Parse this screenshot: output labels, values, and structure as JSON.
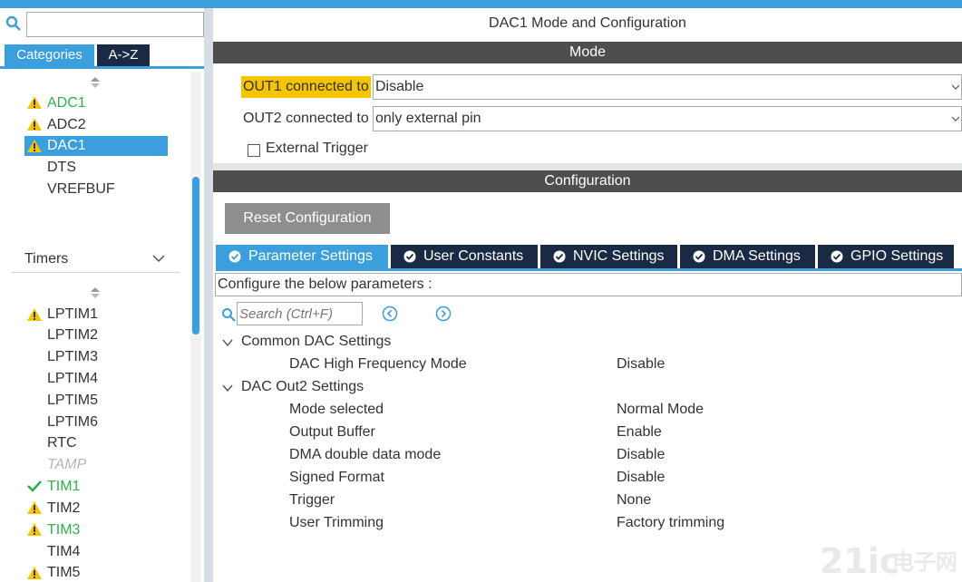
{
  "left": {
    "search_value": "",
    "tabs": {
      "categories": "Categories",
      "az": "A->Z"
    },
    "analog_items": [
      {
        "label": "ADC1",
        "status": "warning-green"
      },
      {
        "label": "ADC2",
        "status": "warning"
      },
      {
        "label": "DAC1",
        "status": "warning-selected"
      },
      {
        "label": "DTS",
        "status": "none"
      },
      {
        "label": "VREFBUF",
        "status": "none"
      }
    ],
    "timers_label": "Timers",
    "timer_items": [
      {
        "label": "LPTIM1",
        "status": "warning"
      },
      {
        "label": "LPTIM2",
        "status": "none"
      },
      {
        "label": "LPTIM3",
        "status": "none"
      },
      {
        "label": "LPTIM4",
        "status": "none"
      },
      {
        "label": "LPTIM5",
        "status": "none"
      },
      {
        "label": "LPTIM6",
        "status": "none"
      },
      {
        "label": "RTC",
        "status": "none"
      },
      {
        "label": "TAMP",
        "status": "disabled"
      },
      {
        "label": "TIM1",
        "status": "check"
      },
      {
        "label": "TIM2",
        "status": "warning"
      },
      {
        "label": "TIM3",
        "status": "warning-green"
      },
      {
        "label": "TIM4",
        "status": "none"
      },
      {
        "label": "TIM5",
        "status": "warning"
      }
    ]
  },
  "main": {
    "title": "DAC1 Mode and Configuration",
    "mode_header": "Mode",
    "out1_label": "OUT1 connected to",
    "out1_value": "Disable",
    "out2_label": "OUT2 connected to",
    "out2_value": "only external pin",
    "external_trigger_label": "External Trigger",
    "config_header": "Configuration",
    "reset_button": "Reset Configuration",
    "tabs": [
      "Parameter Settings",
      "User Constants",
      "NVIC Settings",
      "DMA Settings",
      "GPIO Settings"
    ],
    "configure_text": "Configure the below parameters :",
    "search_placeholder": "Search (Ctrl+F)",
    "groups": [
      {
        "name": "Common DAC Settings",
        "params": [
          {
            "name": "DAC High Frequency Mode",
            "value": "Disable"
          }
        ]
      },
      {
        "name": "DAC Out2 Settings",
        "params": [
          {
            "name": "Mode selected",
            "value": "Normal Mode"
          },
          {
            "name": "Output Buffer",
            "value": "Enable"
          },
          {
            "name": "DMA double data mode",
            "value": "Disable"
          },
          {
            "name": "Signed Format",
            "value": "Disable"
          },
          {
            "name": "Trigger",
            "value": "None"
          },
          {
            "name": "User Trimming",
            "value": "Factory trimming"
          }
        ]
      }
    ]
  },
  "colors": {
    "accent": "#3a9fdc",
    "dark_tab": "#1b2a44",
    "section_bar": "#4e4e4e",
    "highlight": "#f5c400",
    "warning": "#f5c400",
    "ok_green": "#2bb34a"
  }
}
